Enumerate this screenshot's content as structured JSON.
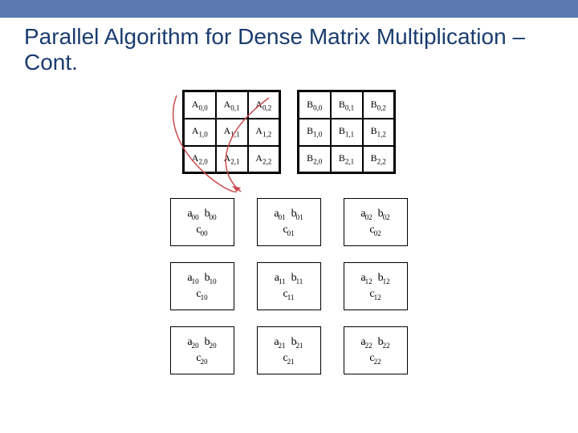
{
  "title": "Parallel Algorithm for Dense Matrix Multiplication –Cont.",
  "matrixA": [
    [
      "A",
      "0,0",
      "A",
      "0,1",
      "A",
      "0,2"
    ],
    [
      "A",
      "1,0",
      "A",
      "1,1",
      "A",
      "1,2"
    ],
    [
      "A",
      "2,0",
      "A",
      "2,1",
      "A",
      "2,2"
    ]
  ],
  "matrixB": [
    [
      "B",
      "0,0",
      "B",
      "0,1",
      "B",
      "0,2"
    ],
    [
      "B",
      "1,0",
      "B",
      "1,1",
      "B",
      "1,2"
    ],
    [
      "B",
      "2,0",
      "B",
      "2,1",
      "B",
      "2,2"
    ]
  ],
  "procs": [
    [
      {
        "a": "00",
        "b": "00",
        "c": "00"
      },
      {
        "a": "01",
        "b": "01",
        "c": "01"
      },
      {
        "a": "02",
        "b": "02",
        "c": "02"
      }
    ],
    [
      {
        "a": "10",
        "b": "10",
        "c": "10"
      },
      {
        "a": "11",
        "b": "11",
        "c": "11"
      },
      {
        "a": "12",
        "b": "12",
        "c": "12"
      }
    ],
    [
      {
        "a": "20",
        "b": "20",
        "c": "20"
      },
      {
        "a": "21",
        "b": "21",
        "c": "21"
      },
      {
        "a": "22",
        "b": "22",
        "c": "22"
      }
    ]
  ],
  "labels": {
    "a": "a",
    "b": "b",
    "c": "c"
  }
}
